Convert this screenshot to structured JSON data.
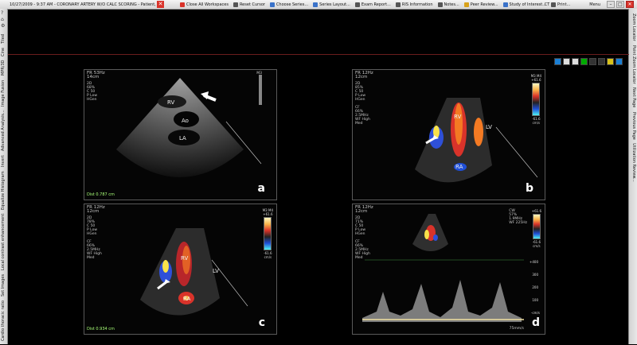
{
  "toolbar": {
    "title": "10/27/2009 - 9:37 AM - CORONARY ARTERY W/O CALC SCORING - Patient, 0",
    "buttons": [
      {
        "label": "Close All Workspaces",
        "color": "#d9332a"
      },
      {
        "label": "Reset Cursor",
        "color": "#555555"
      },
      {
        "label": "Choose Series...",
        "color": "#3a72c9"
      },
      {
        "label": "Series Layout...",
        "color": "#3a72c9"
      },
      {
        "label": "Exam Report...",
        "color": "#555555"
      },
      {
        "label": "RIS Information",
        "color": "#555555"
      },
      {
        "label": "Notes...",
        "color": "#555555"
      },
      {
        "label": "Peer Review...",
        "color": "#d9a21a"
      },
      {
        "label": "Study of Interest...",
        "color": "#3a72c9"
      },
      {
        "label": "Print...",
        "color": "#555555"
      }
    ],
    "modality": "CT",
    "menu_label": "Menu",
    "window_controls": {
      "minimize": "–",
      "restore": "□",
      "close": "✕"
    }
  },
  "left_panel": {
    "top_icons": [
      "?",
      "⌂",
      "⚙"
    ],
    "tabs": [
      "Cardio thoracic ratio",
      "Set Images",
      "Local contrast enhancement",
      "Equalize Histogram",
      "Invert",
      "Advanced Analysis...",
      "Image Fusion",
      "MPR/3D",
      "Cine",
      "Tiled"
    ]
  },
  "right_panel": {
    "tabs": [
      "Zoom Locator",
      "Point Zoom Locator",
      "Next Page",
      "Previous Page",
      "Utilization Review..."
    ]
  },
  "panels": {
    "a": {
      "header": "FR 53Hz\n14cm",
      "params": "2D\n68%\nC 50\nP Low\nHGen",
      "labels": {
        "rv": "RV",
        "ao": "Ao",
        "la": "LA"
      },
      "distance": "Dist 0.787 cm",
      "letter": "a",
      "scale_top": "M3"
    },
    "b": {
      "header": "FR 12Hz\n12cm",
      "params": "2D\n85%\nC 50\nP Low\nHGen\n\nCF\n66%\n2.5MHz\nWF High\nMed",
      "labels": {
        "rv": "RV",
        "lv": "LV",
        "ra": "RA"
      },
      "letter": "b",
      "scale_top": "+61.6",
      "scale_bottom": "-61.6",
      "scale_unit": "cm/s",
      "scale_title": "M3 M4"
    },
    "c": {
      "header": "FR 12Hz\n12cm",
      "params": "2D\n78%\nC 50\nP Low\nHGen\n\nCF\n66%\n2.5MHz\nWF High\nMed",
      "labels": {
        "rv": "RV",
        "lv": "LV",
        "ra": "RA"
      },
      "distance": "Dist 0.934 cm",
      "letter": "c",
      "scale_top": "+61.6",
      "scale_bottom": "-61.6",
      "scale_unit": "cm/s",
      "scale_title": "M3 M4"
    },
    "d": {
      "header": "FR 12Hz\n12cm",
      "params": "2D\n71%\nC 50\nP Low\nHGen\n\nCF\n66%\n2.5MHz\nWF High\nMed",
      "cw": "CW\n57%\n1.9MHz\nWF 225Hz",
      "scale_top": "+61.6",
      "scale_bottom": "-61.6",
      "scale_unit": "cm/s",
      "doppler_ticks": [
        "+400",
        "300",
        "200",
        "100",
        "-cm/s"
      ],
      "sweep": "75mm/s",
      "letter": "d"
    }
  },
  "colors": {
    "accent": "#d9332a",
    "border": "#6b1d1d",
    "distance_text": "#a8ff78"
  }
}
